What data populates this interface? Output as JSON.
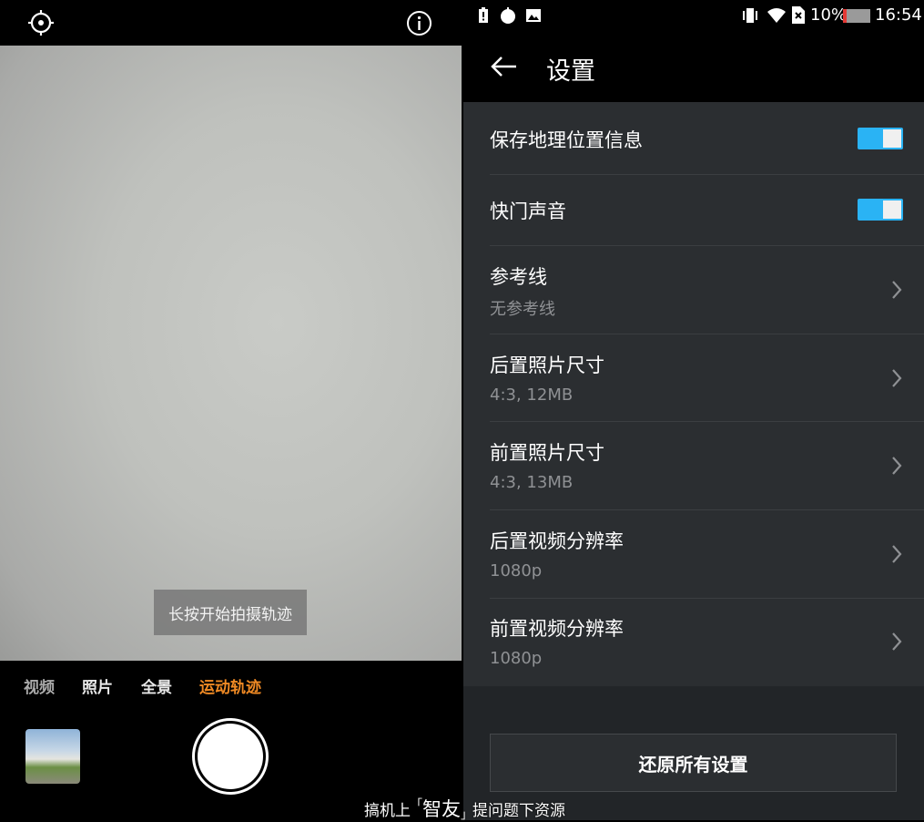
{
  "camera": {
    "hint": "长按开始拍摄轨迹",
    "modes": [
      "视频",
      "照片",
      "全景",
      "运动轨迹"
    ],
    "active_mode_color": "#f08a24",
    "icons": {
      "top_left": "focus-icon",
      "top_right": "info-icon"
    }
  },
  "status_bar": {
    "battery_percent": "10%",
    "time": "16:54"
  },
  "settings": {
    "title": "设置",
    "toggles": [
      {
        "label": "保存地理位置信息",
        "on": true
      },
      {
        "label": "快门声音",
        "on": true
      }
    ],
    "items": [
      {
        "label": "参考线",
        "value": "无参考线"
      },
      {
        "label": "后置照片尺寸",
        "value": "4:3, 12MB"
      },
      {
        "label": "前置照片尺寸",
        "value": "4:3, 13MB"
      },
      {
        "label": "后置视频分辨率",
        "value": "1080p"
      },
      {
        "label": "前置视频分辨率",
        "value": "1080p"
      }
    ],
    "reset_label": "还原所有设置"
  },
  "watermark": {
    "prefix": "搞机上",
    "brand": "智友",
    "suffix": "提问题下资源"
  },
  "colors": {
    "toggle_on": "#2ab3f4",
    "panel_bg": "#2b2e31"
  }
}
